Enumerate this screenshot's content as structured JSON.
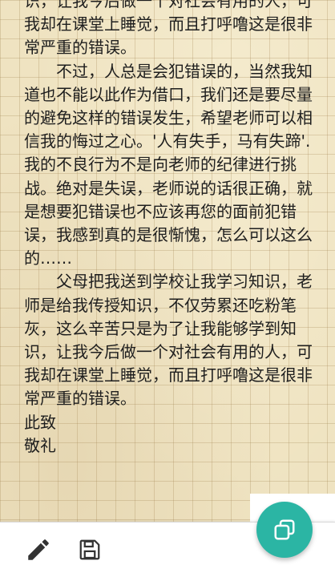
{
  "letter": {
    "p1_tail": "识，让我今后做一个对社会有用的人，可我却在课堂上睡觉，而且打呼噜这是很非常严重的错误。",
    "p2": "不过，人总是会犯错误的，当然我知道也不能以此作为借口，我们还是要尽量的避免这样的错误发生，希望老师可以相信我的悔过之心。'人有失手，马有失蹄'.我的不良行为不是向老师的纪律进行挑战。绝对是失误，老师说的话很正确，就是想要犯错误也不应该再您的面前犯错误，我感到真的是很惭愧，怎么可以这么的……",
    "p3": "父母把我送到学校让我学习知识，老师是给我传授知识，不仅劳累还吃粉笔灰，这么辛苦只是为了让我能够学到知识，让我今后做一个对社会有用的人，可我却在课堂上睡觉，而且打呼噜这是很非常严重的错误。",
    "closing": "此致",
    "salute": "敬礼"
  },
  "toolbar": {
    "edit_icon": "pencil-icon",
    "save_icon": "floppy-disk-icon"
  },
  "fab": {
    "icon": "copy-icon",
    "color": "#2bb5a4"
  }
}
